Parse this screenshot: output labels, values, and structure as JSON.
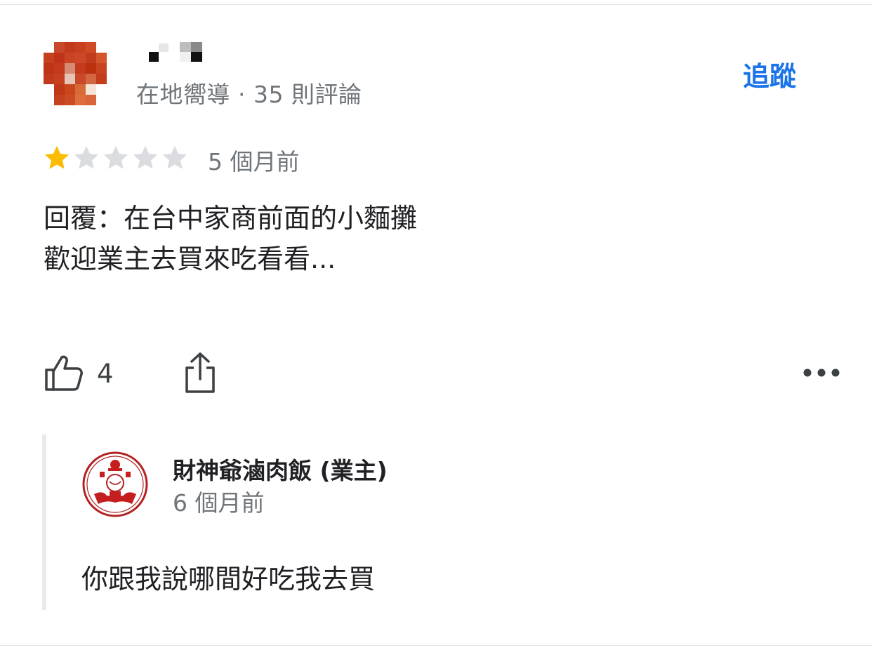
{
  "reviewer": {
    "meta": "在地嚮導 · 35 則評論",
    "follow_label": "追蹤",
    "avatar_icon": "pixelated-avatar"
  },
  "review": {
    "rating": 1,
    "max_rating": 5,
    "time": "5 個月前",
    "lines": [
      "回覆：在台中家商前面的小麵攤",
      "歡迎業主去買來吃看看..."
    ]
  },
  "actions": {
    "like_count": "4",
    "like_icon": "thumbs-up-icon",
    "share_icon": "share-icon",
    "more_icon": "more-options-icon"
  },
  "owner_reply": {
    "name": "財神爺滷肉飯 (業主)",
    "time": "6 個月前",
    "text": "你跟我說哪間好吃我去買",
    "logo_icon": "owner-logo"
  },
  "colors": {
    "accent": "#1a73e8",
    "star_filled": "#fbbc04",
    "star_empty": "#dadce0",
    "muted_text": "#70757a"
  }
}
